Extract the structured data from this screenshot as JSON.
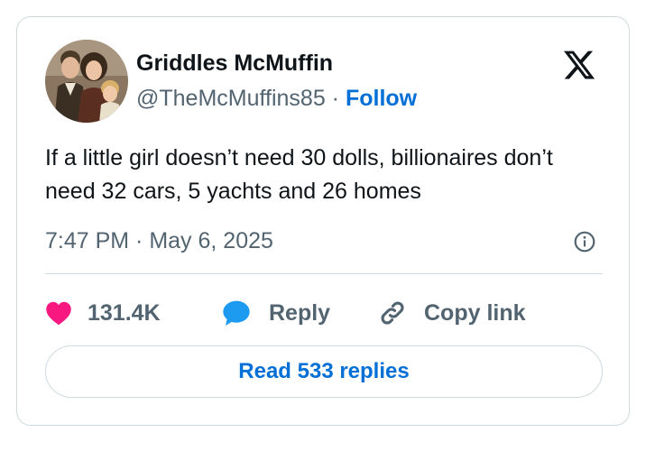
{
  "author": {
    "name": "Griddles McMuffin",
    "handle": "@TheMcMuffins85",
    "separator": "·",
    "follow_label": "Follow",
    "avatar_icon": "family-photo-avatar"
  },
  "brand_icon": "x-logo-icon",
  "tweet": {
    "text": "If a little girl doesn’t need 30 dolls, billionaires don’t need 32 cars, 5 yachts and 26 homes",
    "timestamp": "7:47 PM · May 6, 2025"
  },
  "actions": {
    "like_count": "131.4K",
    "reply_label": "Reply",
    "copy_label": "Copy link"
  },
  "read_replies_label": "Read 533 replies",
  "colors": {
    "like": "#f91880",
    "reply_bubble": "#1d9bf0",
    "link_blue": "#006fd6",
    "muted": "#536471",
    "border": "#cfd9de"
  }
}
